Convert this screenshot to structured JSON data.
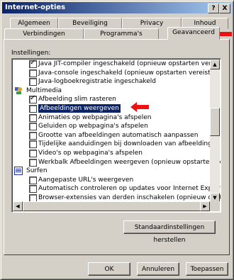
{
  "window": {
    "title": "Internet-opties",
    "help_btn": "?",
    "close_btn": "X"
  },
  "tabs": {
    "row1": [
      "Algemeen",
      "Beveiliging",
      "Privacy",
      "Inhoud"
    ],
    "row2": [
      "Verbindingen",
      "Programma's",
      "Geavanceerd"
    ]
  },
  "settings_label": "Instellingen:",
  "items": [
    {
      "label": "Java JIT-compiler ingeschakeld (opnieuw opstarten vereist)",
      "checked": true
    },
    {
      "label": "Java-console ingeschakeld (opnieuw opstarten vereist)",
      "checked": false
    },
    {
      "label": "Java-logboekregistratie ingeschakeld",
      "checked": false
    },
    {
      "label": "Multimedia",
      "group": true
    },
    {
      "label": "Afbeelding slim rasteren",
      "checked": true
    },
    {
      "label": "Afbeeldingen weergeven",
      "checked": false,
      "selected": true
    },
    {
      "label": "Animaties op webpagina's afspelen",
      "checked": false
    },
    {
      "label": "Geluiden op webpagina's afspelen",
      "checked": false
    },
    {
      "label": "Grootte van afbeeldingen automatisch aanpassen",
      "checked": false
    },
    {
      "label": "Tijdelijke aanduidingen bij downloaden van afbeeldingen weerge",
      "checked": false
    },
    {
      "label": "Video's op webpagina's afspelen",
      "checked": false
    },
    {
      "label": "Werkbalk Afbeeldingen weergeven (opnieuw opstarten noodza",
      "checked": false
    },
    {
      "label": "Surfen",
      "group": true
    },
    {
      "label": "Aangepaste URL's weergeven",
      "checked": false
    },
    {
      "label": "Automatisch controleren op updates voor Internet Explorer",
      "checked": false
    },
    {
      "label": "Browser-extensies van derden inschakelen (opnieuw opstarten",
      "checked": false
    }
  ],
  "buttons": {
    "restore": "Standaardinstellingen herstellen",
    "ok": "OK",
    "cancel": "Annuleren",
    "apply": "Toepassen"
  },
  "colors": {
    "annotation_arrow": "#ee1111",
    "title_active": "#0a246a",
    "selection": "#0a246a"
  }
}
